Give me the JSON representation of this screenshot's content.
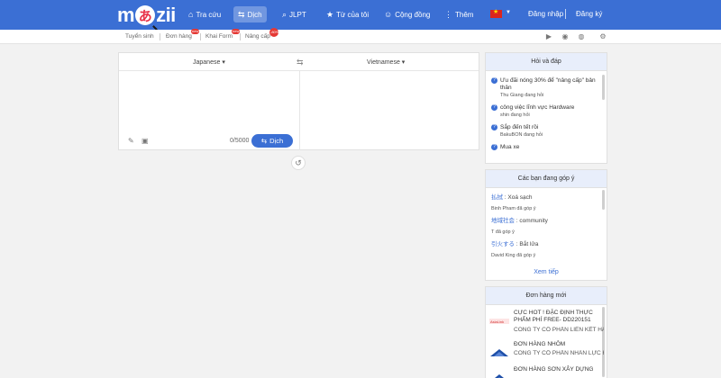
{
  "header": {
    "logo": {
      "m": "m",
      "ka": "あ",
      "zii": "zii"
    },
    "nav": [
      {
        "icon": "home-icon",
        "glyph": "⌂",
        "label": "Tra cứu"
      },
      {
        "icon": "translate-icon",
        "glyph": "⇆",
        "label": "Dịch"
      },
      {
        "icon": "search-icon",
        "glyph": "⌕",
        "label": "JLPT"
      },
      {
        "icon": "star-icon",
        "glyph": "★",
        "label": "Từ của tôi"
      },
      {
        "icon": "people-icon",
        "glyph": "☺",
        "label": "Cộng đồng"
      },
      {
        "icon": "more-icon",
        "glyph": "⋮",
        "label": "Thêm"
      }
    ],
    "login": "Đăng nhập",
    "register": "Đăng ký",
    "accent": "#3b6fd4"
  },
  "subnav": {
    "items": [
      "Tuyển sinh",
      "Đơn hàng",
      "Khai Form",
      "Nâng cấp"
    ],
    "badges": [
      "new",
      "new",
      "-80%"
    ]
  },
  "translator": {
    "source_lang": "Japanese",
    "target_lang": "Vietnamese",
    "count": "0/5000",
    "button": "Dịch"
  },
  "qa": {
    "title": "Hỏi và đáp",
    "items": [
      {
        "text": "Ưu đãi nóng 30% để \"nâng cấp\" bản thân",
        "by": "Thu Giang đang hỏi"
      },
      {
        "text": "công việc lĩnh vực Hardware",
        "by": "shin đang hỏi"
      },
      {
        "text": "Sắp đến tết rồi",
        "by": "BakuBON đang hỏi"
      },
      {
        "text": "Mua xe",
        "by": ""
      }
    ]
  },
  "contrib": {
    "title": "Các bạn đang góp ý",
    "items": [
      {
        "word": "払拭",
        "meaning": " : Xoá sạch",
        "by": "Binh Pham đã góp ý"
      },
      {
        "word": "地域社会",
        "meaning": " : community",
        "by": "T  đã góp ý"
      },
      {
        "word": "引火する",
        "meaning": " : Bắt lửa",
        "by": "David King đã góp ý"
      }
    ],
    "more": "Xem tiếp"
  },
  "jobs": {
    "title": "Đơn hàng mới",
    "items": [
      {
        "title": "CỰC HOT ! ĐẶC ĐỊNH THỰC PHẨM PHÍ FREE- DD220151",
        "company": "CÔNG TY CỔ PHẦN LIÊN KẾT HÀ ..."
      },
      {
        "title": "ĐƠN HÀNG NHÔM",
        "company": "CÔNG TY CỔ PHẦN NHÂN LỰC H..."
      },
      {
        "title": "ĐƠN HÀNG SƠN XÂY DỰNG",
        "company": ""
      }
    ]
  }
}
